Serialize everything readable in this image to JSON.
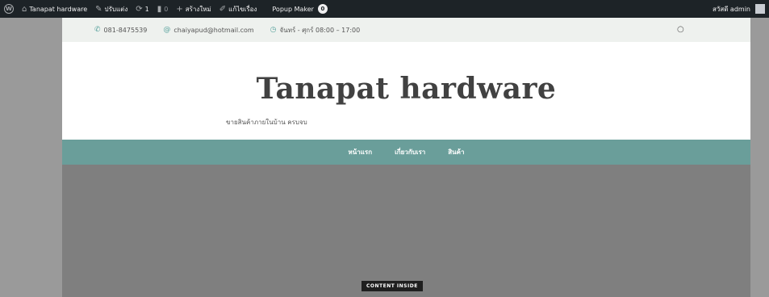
{
  "adminbar": {
    "site_name": "Tanapat hardware",
    "customize": "ปรับแต่ง",
    "updates_count": "1",
    "comments_count": "0",
    "new": "สร้างใหม่",
    "edit": "แก้ไขเรื่อง",
    "popup_maker": "Popup Maker",
    "popup_badge": "0",
    "greeting": "สวัสดี admin"
  },
  "topbar": {
    "phone": "081-8475539",
    "email": "chaiyapud@hotmail.com",
    "hours": "จันทร์ - ศุกร์ 08:00 – 17:00"
  },
  "header": {
    "title": "Tanapat hardware",
    "tagline": "ขายสินค้าภายในบ้าน ครบจบ"
  },
  "nav": {
    "items": [
      "หน้าแรก",
      "เกี่ยวกับเรา",
      "สินค้า"
    ]
  },
  "hero": {
    "badge": "CONTENT INSIDE"
  },
  "icons": {
    "wp": "wordpress-icon",
    "home": "home-icon",
    "brush": "brush-icon",
    "updates": "updates-icon",
    "comments": "comment-icon",
    "plus": "plus-icon",
    "pencil": "pencil-icon",
    "phone": "phone-icon",
    "at": "at-icon",
    "clock": "clock-icon",
    "search": "search-icon"
  },
  "colors": {
    "adminbar": "#1d2327",
    "nav": "#6a9e9a",
    "topbar": "#eef1ee",
    "hero": "#7f7f7f"
  }
}
